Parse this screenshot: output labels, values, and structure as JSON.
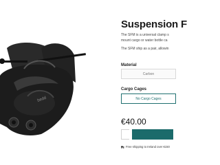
{
  "product": {
    "title": "Suspension F",
    "description_line1": "The SFM is a universal clamp s",
    "description_line2": "mount cargo or water bottle ca",
    "description_line3": "The SFM ship as a pair, allowin"
  },
  "options": {
    "material_label": "Material",
    "material_value": "Carbon",
    "cages_label": "Cargo Cages",
    "cages_value": "No Cargo Cages"
  },
  "price": "€40.00",
  "shipping_note": "Free shipping to Ireland over €150",
  "colors": {
    "accent": "#1b6b6b",
    "clamp_body": "#1c1c1c"
  },
  "icons": [
    "truck-icon"
  ]
}
